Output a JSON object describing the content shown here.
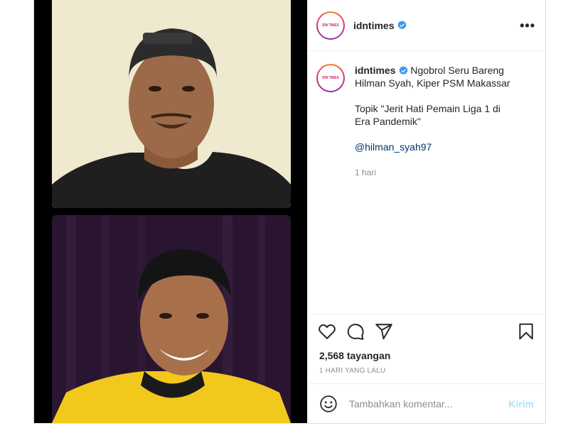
{
  "header": {
    "avatar_text": "IDN TIMES",
    "username": "idntimes",
    "more": "•••"
  },
  "caption": {
    "username": "idntimes",
    "line1": "Ngobrol Seru Bareng Hilman Syah, Kiper PSM Makassar",
    "line2": "Topik \"Jerit Hati Pemain Liga 1 di Era Pandemik\"",
    "mention": "@hilman_syah97",
    "time": "1 hari"
  },
  "stats": {
    "views": "2,568 tayangan",
    "date": "1 HARI YANG LALU"
  },
  "comment": {
    "placeholder": "Tambahkan komentar...",
    "post_label": "Kirim"
  },
  "colors": {
    "verified": "#3897f0",
    "post_button": "#b2dffc",
    "link": "#00376b",
    "muted": "#8e8e8e"
  },
  "icons": [
    "heart-icon",
    "comment-icon",
    "share-icon",
    "bookmark-icon",
    "emoji-icon",
    "verified-badge-icon",
    "more-icon"
  ]
}
